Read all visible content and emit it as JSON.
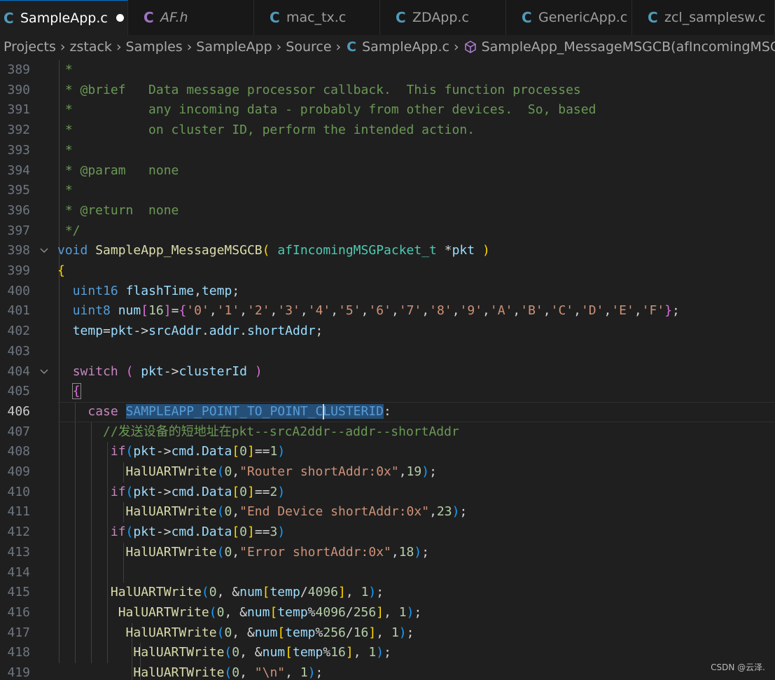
{
  "tabs": [
    {
      "label": "SampleApp.c",
      "icon": "c-file-icon",
      "active": true,
      "modified": true
    },
    {
      "label": "AF.h",
      "icon": "h-file-icon",
      "active": false,
      "italic": true
    },
    {
      "label": "mac_tx.c",
      "icon": "c-file-icon",
      "active": false
    },
    {
      "label": "ZDApp.c",
      "icon": "c-file-icon",
      "active": false
    },
    {
      "label": "GenericApp.c",
      "icon": "c-file-icon",
      "active": false
    },
    {
      "label": "zcl_samplesw.c",
      "icon": "c-file-icon",
      "active": false
    }
  ],
  "breadcrumb": [
    "Projects",
    "zstack",
    "Samples",
    "SampleApp",
    "Source",
    "SampleApp.c",
    "SampleApp_MessageMSGCB(afIncomingMSGPacke"
  ],
  "editor": {
    "current_line": 406,
    "lines": [
      {
        "n": "389",
        "text": " *"
      },
      {
        "n": "390",
        "text": " * @brief   Data message processor callback.  This function processes"
      },
      {
        "n": "391",
        "text": " *          any incoming data - probably from other devices.  So, based"
      },
      {
        "n": "392",
        "text": " *          on cluster ID, perform the intended action."
      },
      {
        "n": "393",
        "text": " *"
      },
      {
        "n": "394",
        "text": " * @param   none"
      },
      {
        "n": "395",
        "text": " *"
      },
      {
        "n": "396",
        "text": " * @return  none"
      },
      {
        "n": "397",
        "text": " */"
      },
      {
        "n": "398",
        "text": "void SampleApp_MessageMSGCB( afIncomingMSGPacket_t *pkt )"
      },
      {
        "n": "399",
        "text": "{"
      },
      {
        "n": "400",
        "text": "  uint16 flashTime,temp;"
      },
      {
        "n": "401",
        "text": "  uint8 num[16]={'0','1','2','3','4','5','6','7','8','9','A','B','C','D','E','F'};"
      },
      {
        "n": "402",
        "text": "  temp=pkt->srcAddr.addr.shortAddr;"
      },
      {
        "n": "403",
        "text": ""
      },
      {
        "n": "404",
        "text": "  switch ( pkt->clusterId )"
      },
      {
        "n": "405",
        "text": "  {"
      },
      {
        "n": "406",
        "text": "    case SAMPLEAPP_POINT_TO_POINT_CLUSTERID:"
      },
      {
        "n": "407",
        "text": "      //发送设备的短地址在pkt--srcA2ddr--addr--shortAddr"
      },
      {
        "n": "408",
        "text": "       if(pkt->cmd.Data[0]==1)"
      },
      {
        "n": "409",
        "text": "         HalUARTWrite(0,\"Router shortAddr:0x\",19);"
      },
      {
        "n": "410",
        "text": "       if(pkt->cmd.Data[0]==2)"
      },
      {
        "n": "411",
        "text": "         HalUARTWrite(0,\"End Device shortAddr:0x\",23);"
      },
      {
        "n": "412",
        "text": "       if(pkt->cmd.Data[0]==3)"
      },
      {
        "n": "413",
        "text": "         HalUARTWrite(0,\"Error shortAddr:0x\",18);"
      },
      {
        "n": "414",
        "text": ""
      },
      {
        "n": "415",
        "text": "       HalUARTWrite(0, &num[temp/4096], 1);"
      },
      {
        "n": "416",
        "text": "        HalUARTWrite(0, &num[temp%4096/256], 1);"
      },
      {
        "n": "417",
        "text": "         HalUARTWrite(0, &num[temp%256/16], 1);"
      },
      {
        "n": "418",
        "text": "          HalUARTWrite(0, &num[temp%16], 1);"
      },
      {
        "n": "419",
        "text": "          HalUARTWrite(0, \"\\n\", 1);"
      }
    ]
  },
  "watermark": "CSDN @云泽.",
  "colors": {
    "background": "#1f1f1f",
    "tabbar": "#181818",
    "comment": "#6a9955",
    "keyword": "#569cd6",
    "control": "#c586c0",
    "type": "#4ec9b0",
    "function": "#dcdcaa",
    "variable": "#9cdcfe",
    "string": "#ce9178",
    "number": "#b5cea8",
    "c_icon": "#519aba",
    "h_icon": "#a074c4"
  }
}
